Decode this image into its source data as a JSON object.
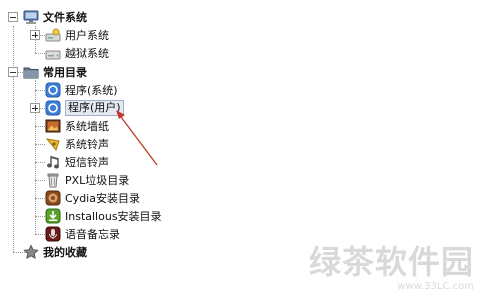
{
  "tree": {
    "filesystem": {
      "label": "文件系统",
      "children": [
        {
          "label": "用户系统",
          "icon": "user-drive-icon"
        },
        {
          "label": "越狱系统",
          "icon": "drive-icon"
        }
      ]
    },
    "common": {
      "label": "常用目录",
      "children": [
        {
          "label": "程序(系统)",
          "icon": "app-system-icon"
        },
        {
          "label": "程序(用户)",
          "icon": "app-user-icon"
        },
        {
          "label": "系统墙纸",
          "icon": "wallpaper-icon"
        },
        {
          "label": "系统铃声",
          "icon": "ringtone-icon"
        },
        {
          "label": "短信铃声",
          "icon": "music-note-icon"
        },
        {
          "label": "PXL垃圾目录",
          "icon": "trash-icon"
        },
        {
          "label": "Cydia安装目录",
          "icon": "cydia-icon"
        },
        {
          "label": "Installous安装目录",
          "icon": "installous-icon"
        },
        {
          "label": "语音备忘录",
          "icon": "voice-memo-icon"
        }
      ]
    },
    "favorites": {
      "label": "我的收藏",
      "icon": "star-icon"
    }
  },
  "watermark": {
    "main": "绿茶软件园",
    "sub": "www.33LC.com"
  },
  "colors": {
    "arrow": "#c0392b",
    "selection": "#e4e9f2"
  }
}
